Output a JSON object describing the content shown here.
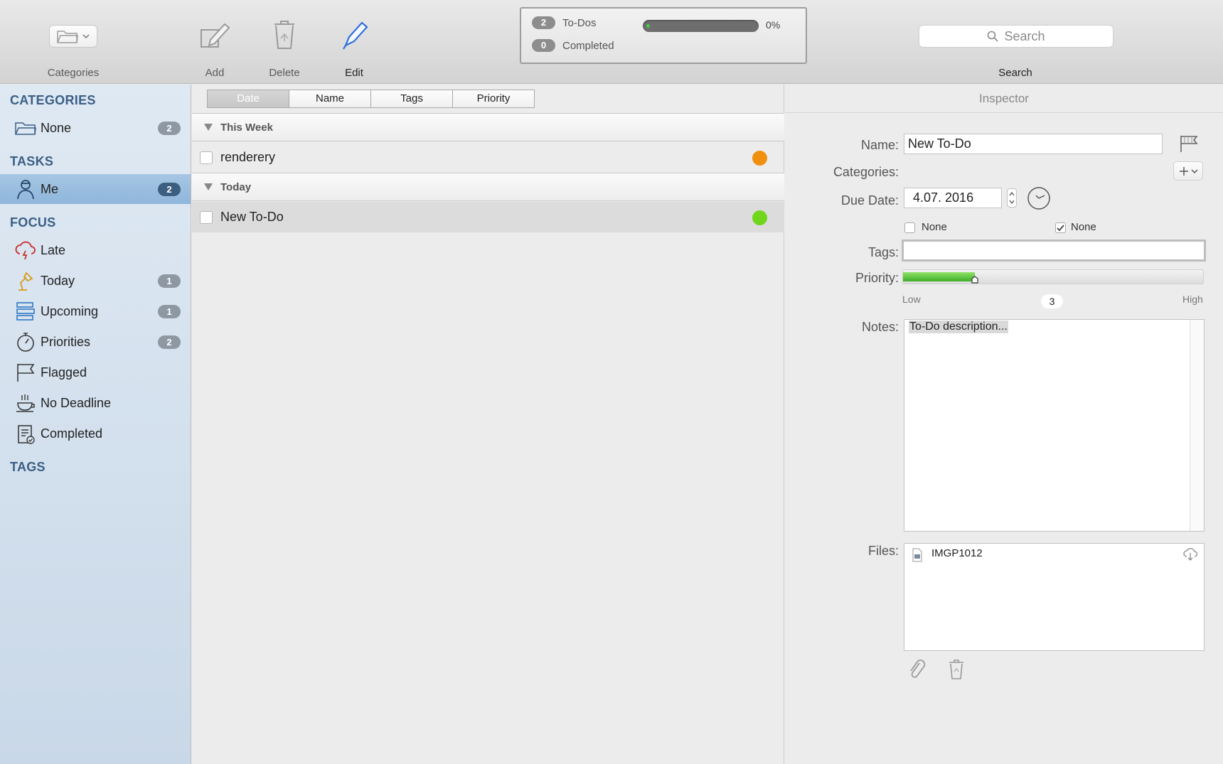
{
  "toolbar": {
    "categories_label": "Categories",
    "add_label": "Add",
    "delete_label": "Delete",
    "edit_label": "Edit",
    "search_placeholder": "Search",
    "search_label": "Search"
  },
  "status": {
    "todos_count": "2",
    "todos_label": "To-Dos",
    "completed_count": "0",
    "completed_label": "Completed",
    "progress_percent": "0%",
    "progress_value": 0
  },
  "sidebar": {
    "categories_header": "CATEGORIES",
    "categories": [
      {
        "label": "None",
        "badge": "2",
        "icon": "folder-icon"
      }
    ],
    "tasks_header": "TASKS",
    "tasks": [
      {
        "label": "Me",
        "badge": "2",
        "icon": "person-icon",
        "selected": true
      }
    ],
    "focus_header": "FOCUS",
    "focus": [
      {
        "label": "Late",
        "badge": "",
        "icon": "storm-cloud-icon"
      },
      {
        "label": "Today",
        "badge": "1",
        "icon": "desk-lamp-icon"
      },
      {
        "label": "Upcoming",
        "badge": "1",
        "icon": "calendar-stack-icon"
      },
      {
        "label": "Priorities",
        "badge": "2",
        "icon": "stopwatch-icon"
      },
      {
        "label": "Flagged",
        "badge": "",
        "icon": "flag-icon"
      },
      {
        "label": "No Deadline",
        "badge": "",
        "icon": "coffee-cup-icon"
      },
      {
        "label": "Completed",
        "badge": "",
        "icon": "clipboard-check-icon"
      }
    ],
    "tags_header": "TAGS"
  },
  "list": {
    "sort_buttons": [
      "Date",
      "Name",
      "Tags",
      "Priority"
    ],
    "active_sort": "Date",
    "groups": [
      {
        "title": "This Week",
        "items": [
          {
            "name": "renderery",
            "priority_color": "#f0900e"
          }
        ]
      },
      {
        "title": "Today",
        "items": [
          {
            "name": "New To-Do",
            "priority_color": "#6fd61c"
          }
        ]
      }
    ]
  },
  "inspector": {
    "title": "Inspector",
    "name_label": "Name:",
    "name_value": "New To-Do",
    "categories_label": "Categories:",
    "due_label": "Due Date:",
    "due_value": "4.07. 2016",
    "none_left": "None",
    "none_right": "None",
    "tags_label": "Tags:",
    "tags_value": "",
    "priority_label": "Priority:",
    "priority_low": "Low",
    "priority_value": "3",
    "priority_high": "High",
    "priority_fraction": 0.24,
    "notes_label": "Notes:",
    "notes_value": "To-Do description...",
    "files_label": "Files:",
    "file_name": "IMGP1012"
  }
}
